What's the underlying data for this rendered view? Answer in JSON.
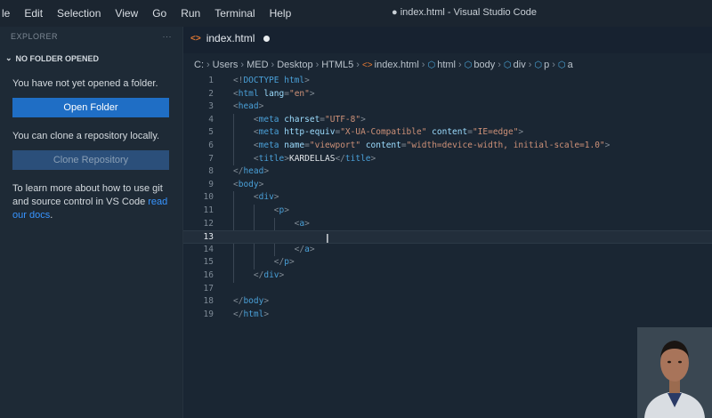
{
  "menubar": {
    "items": [
      "le",
      "Edit",
      "Selection",
      "View",
      "Go",
      "Run",
      "Terminal",
      "Help"
    ],
    "window_title": "● index.html - Visual Studio Code"
  },
  "sidebar": {
    "header": "EXPLORER",
    "more": "···",
    "section": "NO FOLDER OPENED",
    "no_folder_text": "You have not yet opened a folder.",
    "open_folder": "Open Folder",
    "clone_text": "You can clone a repository locally.",
    "clone_button": "Clone Repository",
    "learn_text": "To learn more about how to use git and source control in VS Code ",
    "learn_link": "read our docs",
    "learn_end": "."
  },
  "tab": {
    "icon": "<>",
    "label": "index.html"
  },
  "breadcrumb": [
    "C:",
    "Users",
    "MED",
    "Desktop",
    "HTML5",
    "index.html",
    "html",
    "body",
    "div",
    "p",
    "a"
  ],
  "editor": {
    "current_line": 13,
    "lines": [
      "<!DOCTYPE html>",
      "<html lang=\"en\">",
      "<head>",
      "    <meta charset=\"UTF-8\">",
      "    <meta http-equiv=\"X-UA-Compatible\" content=\"IE=edge\">",
      "    <meta name=\"viewport\" content=\"width=device-width, initial-scale=1.0\">",
      "    <title>KARDELLAS</title>",
      "</head>",
      "<body>",
      "    <div>",
      "        <p>",
      "            <a>",
      "",
      "            </a>",
      "        </p>",
      "    </div>",
      "",
      "</body>",
      "</html>"
    ]
  },
  "colors": {
    "accent": "#1f6ec5",
    "tag": "#4aa0d8",
    "attribute": "#9cdcfe",
    "string": "#ce9178"
  }
}
